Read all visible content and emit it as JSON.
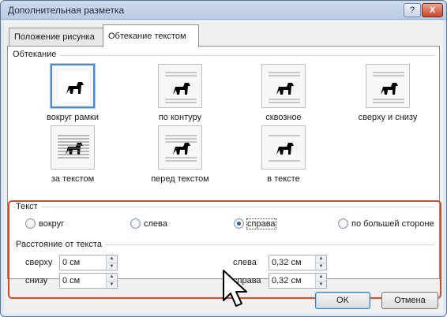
{
  "window": {
    "title": "Дополнительная разметка",
    "help_label": "?",
    "close_label": "X"
  },
  "tabs": [
    {
      "label": "Положение рисунка",
      "active": false
    },
    {
      "label": "Обтекание текстом",
      "active": true
    }
  ],
  "wrapping": {
    "group_label": "Обтекание",
    "options": [
      {
        "label": "вокруг рамки",
        "selected": true
      },
      {
        "label": "по контуру",
        "selected": false
      },
      {
        "label": "сквозное",
        "selected": false
      },
      {
        "label": "сверху и снизу",
        "selected": false
      },
      {
        "label": "за текстом",
        "selected": false
      },
      {
        "label": "перед текстом",
        "selected": false
      },
      {
        "label": "в тексте",
        "selected": false
      }
    ]
  },
  "text_side": {
    "group_label": "Текст",
    "options": [
      {
        "label": "вокруг",
        "checked": false
      },
      {
        "label": "слева",
        "checked": false
      },
      {
        "label": "справа",
        "checked": true
      },
      {
        "label": "по большей стороне",
        "checked": false
      }
    ]
  },
  "distance": {
    "group_label": "Расстояние от текста",
    "top": {
      "label": "сверху",
      "value": "0 см"
    },
    "bottom": {
      "label": "снизу",
      "value": "0 см"
    },
    "left": {
      "label": "слева",
      "value": "0,32 см"
    },
    "right": {
      "label": "справа",
      "value": "0,32 см"
    }
  },
  "buttons": {
    "ok": "OK",
    "cancel": "Отмена"
  },
  "colors": {
    "highlight_frame": "#e2461f",
    "selection": "#4c89cf"
  }
}
